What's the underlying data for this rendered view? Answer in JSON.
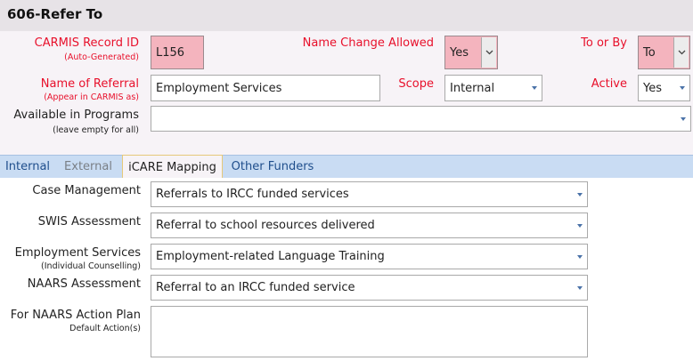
{
  "form": {
    "title": "606-Refer To",
    "record_id": {
      "label": "CARMIS Record ID",
      "sub": "(Auto-Generated)",
      "value": "L156"
    },
    "name_change": {
      "label": "Name Change Allowed",
      "value": "Yes"
    },
    "to_or_by": {
      "label": "To or By",
      "value": "To"
    },
    "name_referral": {
      "label": "Name of Referral",
      "sub": "(Appear in CARMIS as)",
      "value": "Employment Services"
    },
    "scope": {
      "label": "Scope",
      "value": "Internal"
    },
    "active": {
      "label": "Active",
      "value": "Yes"
    },
    "programs": {
      "label": "Available in Programs",
      "sub": "(leave empty for all)",
      "value": ""
    }
  },
  "tabs": [
    {
      "label": "Internal"
    },
    {
      "label": "External"
    },
    {
      "label": "iCARE Mapping"
    },
    {
      "label": "Other Funders"
    }
  ],
  "mapping": {
    "case_mgmt": {
      "label": "Case Management",
      "value": "Referrals to IRCC funded services"
    },
    "swis": {
      "label": "SWIS Assessment",
      "value": "Referral to school resources delivered"
    },
    "employment": {
      "label": "Employment Services",
      "sub": "(Individual Counselling)",
      "value": "Employment-related Language Training"
    },
    "naars": {
      "label": "NAARS Assessment",
      "value": "Referral to an IRCC funded service"
    },
    "action_plan": {
      "label": "For NAARS Action Plan",
      "sub": "Default Action(s)",
      "value": ""
    }
  },
  "colors": {
    "required_label": "#e8102b",
    "required_field": "#f4b4be",
    "tab_strip": "#c9dcf3",
    "tab_text": "#1f4e8c"
  },
  "icons": {
    "dropdown": "chevron-down-icon"
  }
}
